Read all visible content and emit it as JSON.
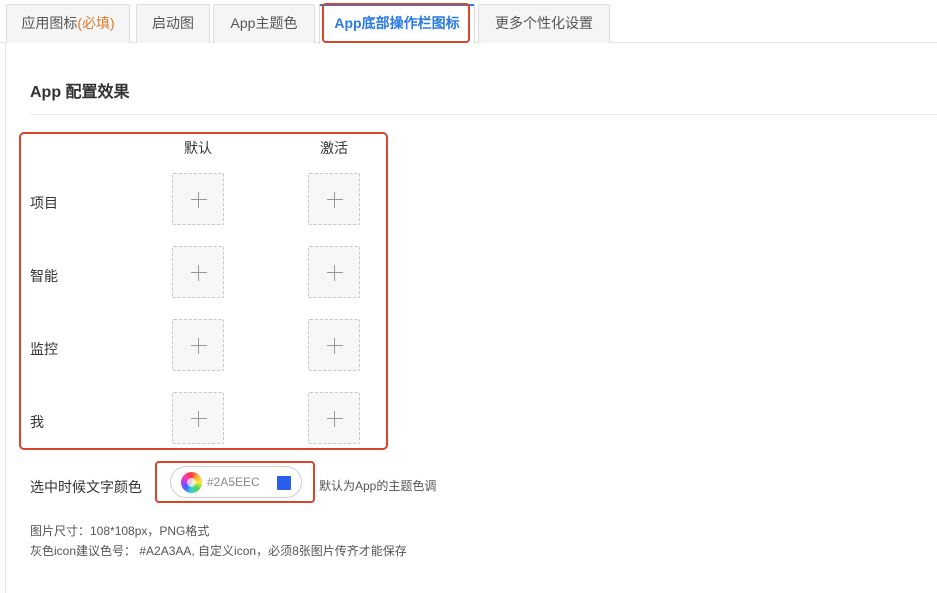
{
  "tabs": [
    {
      "label": "应用图标",
      "required": "(必填)"
    },
    {
      "label": "启动图"
    },
    {
      "label": "App主题色"
    },
    {
      "label": "App底部操作栏图标"
    },
    {
      "label": "更多个性化设置"
    }
  ],
  "section_title": "App 配置效果",
  "grid": {
    "col_default": "默认",
    "col_active": "激活",
    "rows": [
      "项目",
      "智能",
      "监控",
      "我"
    ]
  },
  "color": {
    "label": "选中时候文字颜色",
    "value": "#2A5EEC",
    "swatch_color": "#2A5EEC",
    "hint": "默认为App的主题色调"
  },
  "notes": [
    "图片尺寸：108*108px，PNG格式",
    "灰色icon建议色号： #A2A3AA, 自定义icon，必须8张图片传齐才能保存"
  ],
  "colors": {
    "accent": "#2a7ae2",
    "highlight": "#d9452b",
    "required": "#e07a2a"
  }
}
